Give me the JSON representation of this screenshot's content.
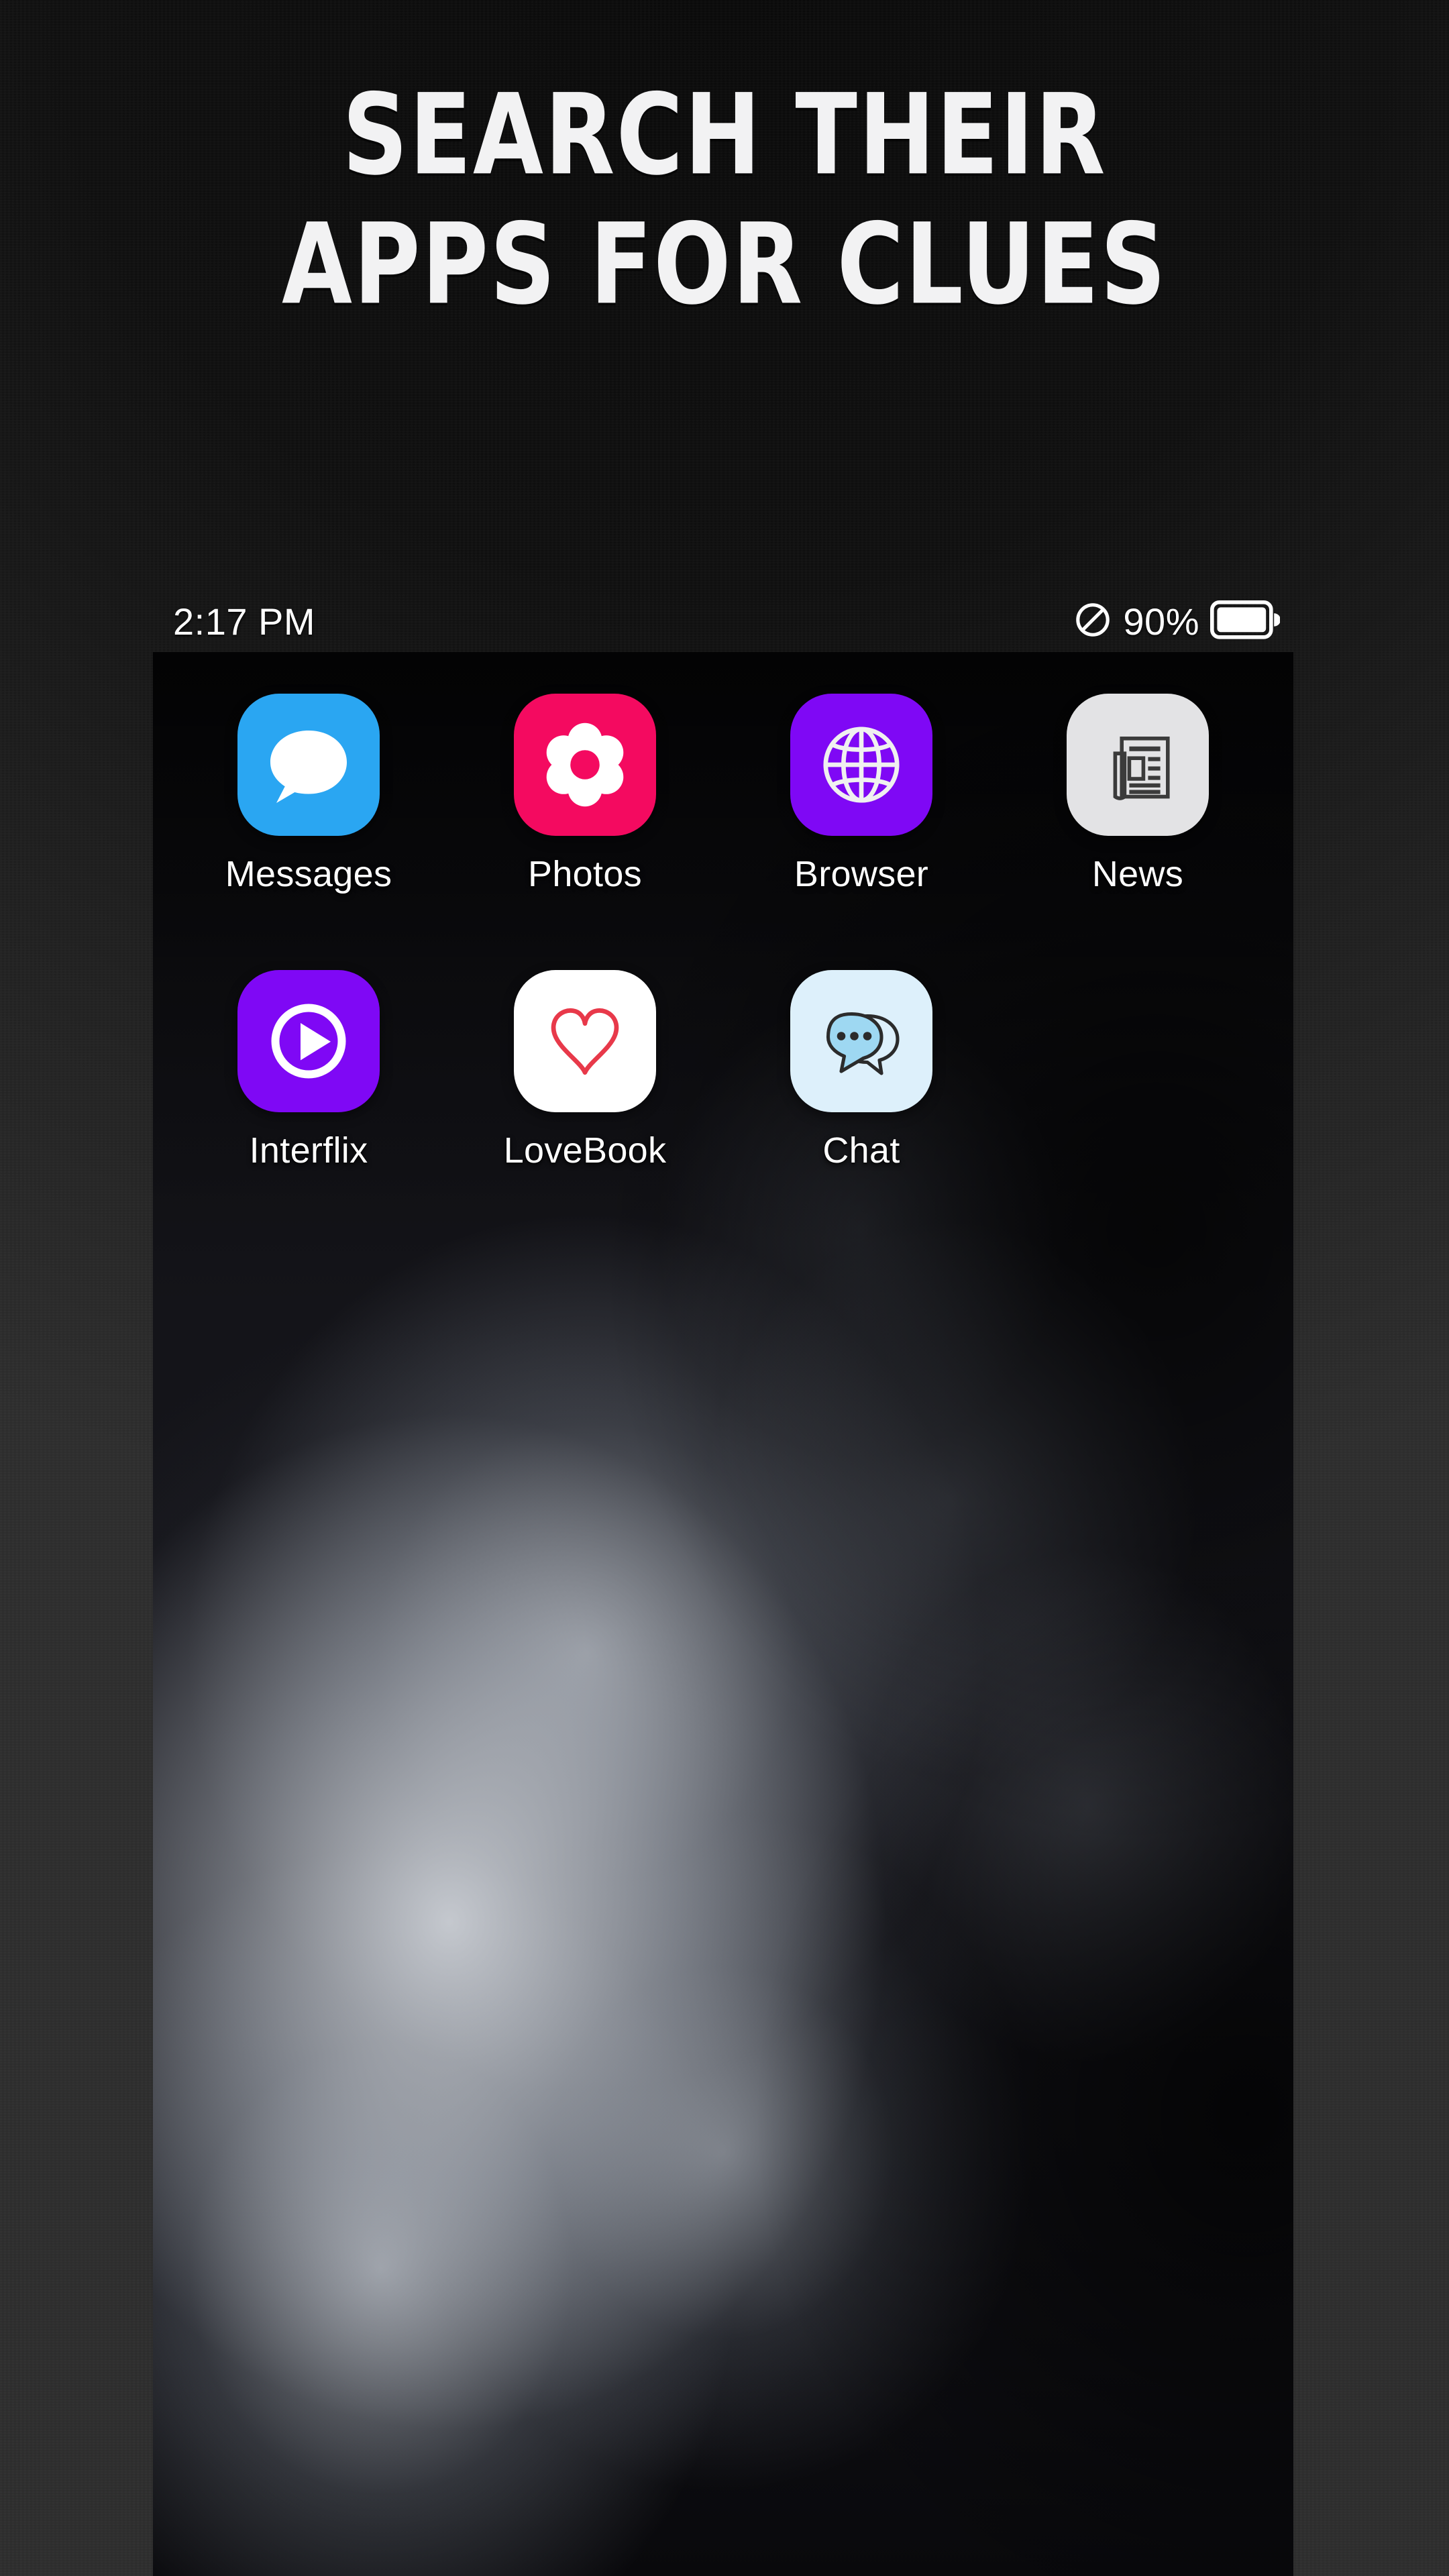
{
  "headline": {
    "line1": "SEARCH THEIR",
    "line2": "APPS FOR CLUES"
  },
  "status_bar": {
    "time": "2:17 PM",
    "battery_percent": "90%",
    "dnd_icon": "no-signal-slash-icon",
    "battery_icon": "battery-full-icon"
  },
  "home_screen": {
    "wallpaper": "smoke-photo",
    "rows": [
      {
        "apps": [
          {
            "label": "Messages",
            "icon": "speech-bubble-icon",
            "bg": "#2aa6f2",
            "fg": "#ffffff"
          },
          {
            "label": "Photos",
            "icon": "flower-icon",
            "bg": "#f40a60",
            "fg": "#ffffff"
          },
          {
            "label": "Browser",
            "icon": "globe-icon",
            "bg": "#7f08f5",
            "fg": "#f2f2f2"
          },
          {
            "label": "News",
            "icon": "newspaper-icon",
            "bg": "#e3e3e5",
            "fg": "#3a3a3a"
          }
        ]
      },
      {
        "apps": [
          {
            "label": "Interflix",
            "icon": "play-circle-icon",
            "bg": "#7f08f5",
            "fg": "#ffffff"
          },
          {
            "label": "LoveBook",
            "icon": "heart-outline-icon",
            "bg": "#ffffff",
            "fg": "#e8394a"
          },
          {
            "label": "Chat",
            "icon": "chat-bubbles-icon",
            "bg": "#ddf0fb",
            "fg": "#9ed8f2"
          }
        ]
      }
    ]
  },
  "colors": {
    "backdrop": "#2c2c2c",
    "headline_text": "#f2f2f3",
    "screen_bg": "#050507"
  }
}
